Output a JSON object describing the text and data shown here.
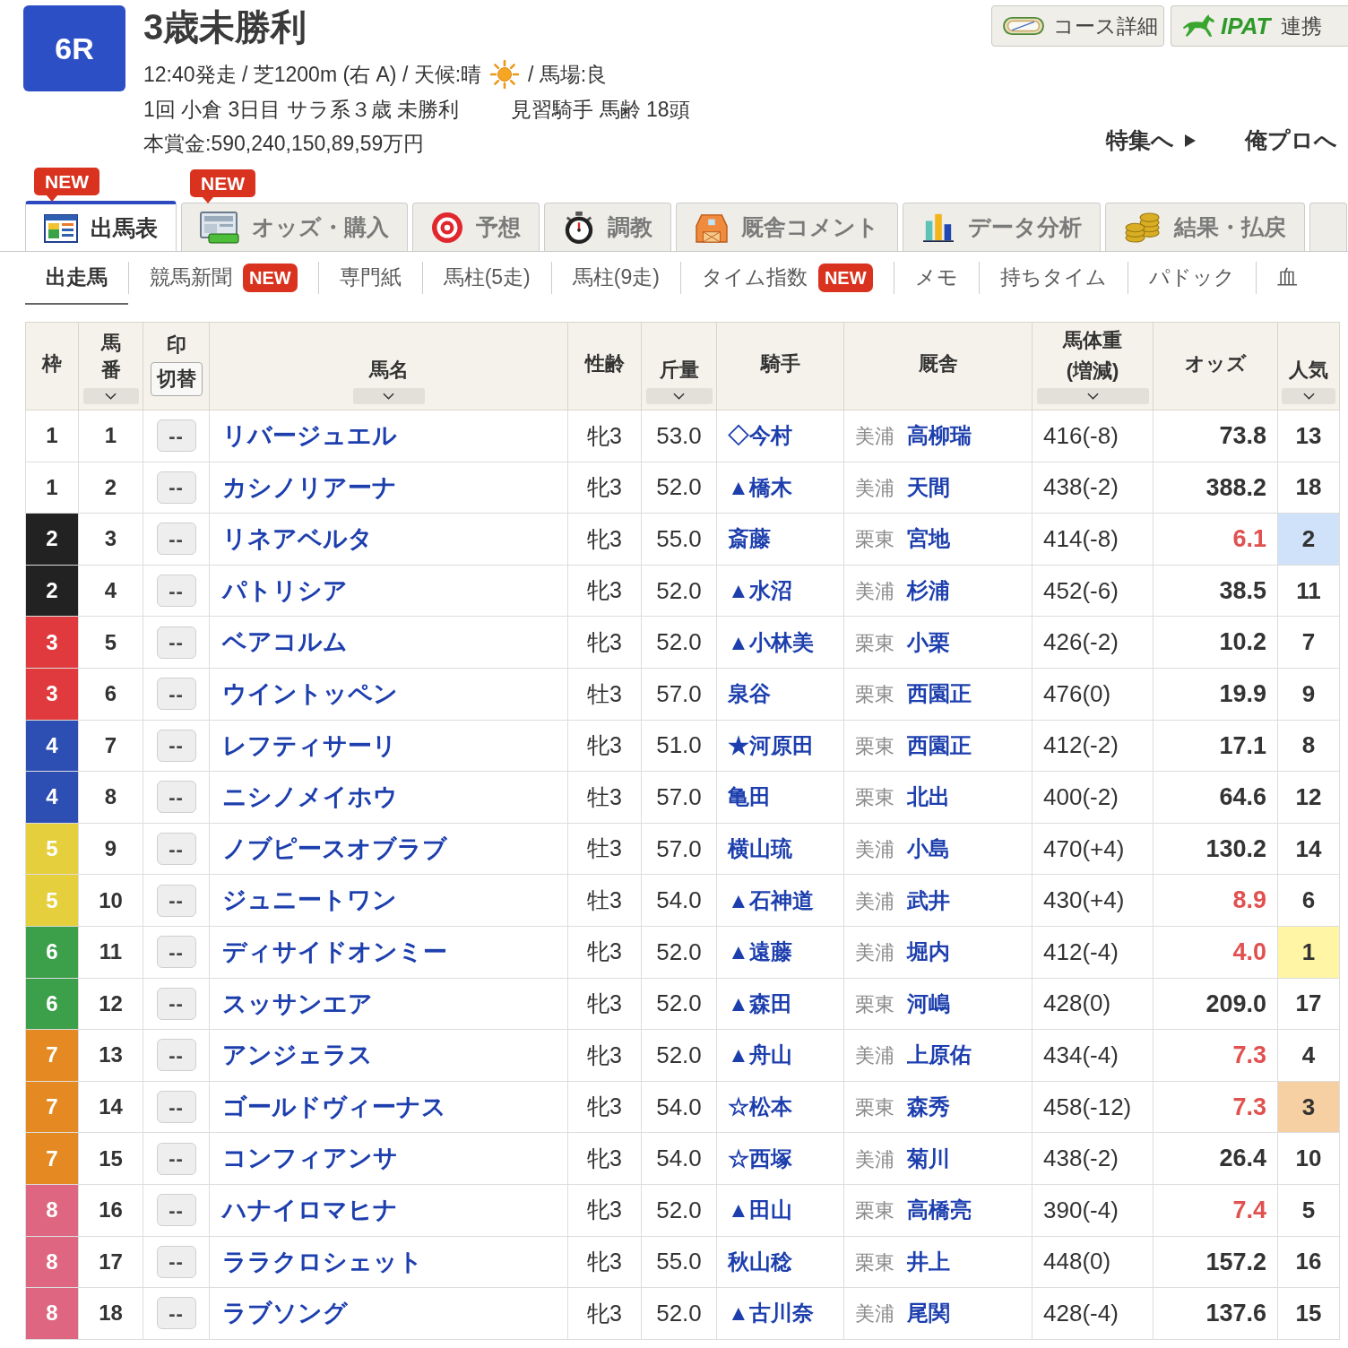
{
  "race": {
    "number": "6R",
    "title": "3歳未勝利",
    "schedule": "12:40発走 / 芝1200m (右 A) / 天候:晴",
    "track_condition": "/ 馬場:良",
    "meeting": "1回 小倉 3日目 サラ系３歳 未勝利",
    "conditions": "見習騎手 馬齢 18頭",
    "prize": "本賞金:590,240,150,89,59万円"
  },
  "header_buttons": [
    {
      "kind": "course",
      "label": "コース詳細"
    },
    {
      "kind": "ipat",
      "logo_text": "IPAT",
      "label": "連携"
    }
  ],
  "header_links": [
    {
      "label": "特集へ",
      "arrow": true
    },
    {
      "label": "俺プロへ",
      "arrow": false
    }
  ],
  "tabs": [
    {
      "kind": "entries",
      "label": "出馬表",
      "selected": true,
      "badge": "NEW"
    },
    {
      "kind": "odds",
      "label": "オッズ・購入",
      "selected": false,
      "badge": "NEW"
    },
    {
      "kind": "prediction",
      "label": "予想",
      "selected": false
    },
    {
      "kind": "training",
      "label": "調教",
      "selected": false
    },
    {
      "kind": "stable",
      "label": "厩舎コメント",
      "selected": false
    },
    {
      "kind": "analysis",
      "label": "データ分析",
      "selected": false
    },
    {
      "kind": "results",
      "label": "結果・払戻",
      "selected": false
    },
    {
      "kind": "clipped",
      "selected": false
    }
  ],
  "subnav": [
    {
      "label": "出走馬",
      "selected": true
    },
    {
      "label": "競馬新聞",
      "selected": false,
      "badge": "NEW"
    },
    {
      "label": "専門紙",
      "selected": false
    },
    {
      "label": "馬柱(5走)",
      "selected": false
    },
    {
      "label": "馬柱(9走)",
      "selected": false
    },
    {
      "label": "タイム指数",
      "selected": false,
      "badge": "NEW"
    },
    {
      "label": "メモ",
      "selected": false
    },
    {
      "label": "持ちタイム",
      "selected": false
    },
    {
      "label": "パドック",
      "selected": false
    },
    {
      "label": "血",
      "selected": false
    }
  ],
  "table": {
    "columns": [
      {
        "label": "枠",
        "sortable": false
      },
      {
        "label": "馬番",
        "sortable": true
      },
      {
        "label": "印",
        "sortable": false,
        "button": "切替"
      },
      {
        "label": "馬名",
        "sortable": true
      },
      {
        "label": "性齢",
        "sortable": false
      },
      {
        "label": "斤量",
        "sortable": true
      },
      {
        "label": "騎手",
        "sortable": false
      },
      {
        "label": "厩舎",
        "sortable": false
      },
      {
        "label": "馬体重",
        "sublabel": "(増減)",
        "sortable": true
      },
      {
        "label": "オッズ",
        "sortable": false
      },
      {
        "label": "人気",
        "sortable": true
      }
    ],
    "rows": [
      {
        "waku": "1",
        "color": "#ffffff",
        "number": "1",
        "mark": "--",
        "name": "リバージュエル",
        "sex_age": "牝3",
        "weight": "53.0",
        "jockey": "◇今村",
        "affiliation": "美浦",
        "trainer": "高柳瑞",
        "body_weight": "416(-8)",
        "odds": "73.8",
        "odds_hot": false,
        "popularity": {
          "rank": "13"
        }
      },
      {
        "waku": "1",
        "color": "#ffffff",
        "number": "2",
        "mark": "--",
        "name": "カシノリアーナ",
        "sex_age": "牝3",
        "weight": "52.0",
        "jockey": "▲橋木",
        "affiliation": "美浦",
        "trainer": "天間",
        "body_weight": "438(-2)",
        "odds": "388.2",
        "odds_hot": false,
        "popularity": {
          "rank": "18"
        }
      },
      {
        "waku": "2",
        "color": "#222222",
        "number": "3",
        "mark": "--",
        "name": "リネアベルタ",
        "sex_age": "牝3",
        "weight": "55.0",
        "jockey": "斎藤",
        "affiliation": "栗東",
        "trainer": "宮地",
        "body_weight": "414(-8)",
        "odds": "6.1",
        "odds_hot": true,
        "popularity": {
          "rank": "2",
          "color": "#cfe2fa"
        }
      },
      {
        "waku": "2",
        "color": "#222222",
        "number": "4",
        "mark": "--",
        "name": "パトリシア",
        "sex_age": "牝3",
        "weight": "52.0",
        "jockey": "▲水沼",
        "affiliation": "美浦",
        "trainer": "杉浦",
        "body_weight": "452(-6)",
        "odds": "38.5",
        "odds_hot": false,
        "popularity": {
          "rank": "11"
        }
      },
      {
        "waku": "3",
        "color": "#e03a3e",
        "number": "5",
        "mark": "--",
        "name": "ベアコルム",
        "sex_age": "牝3",
        "weight": "52.0",
        "jockey": "▲小林美",
        "affiliation": "栗東",
        "trainer": "小栗",
        "body_weight": "426(-2)",
        "odds": "10.2",
        "odds_hot": false,
        "popularity": {
          "rank": "7"
        }
      },
      {
        "waku": "3",
        "color": "#e03a3e",
        "number": "6",
        "mark": "--",
        "name": "ウイントッペン",
        "sex_age": "牡3",
        "weight": "57.0",
        "jockey": "泉谷",
        "affiliation": "栗東",
        "trainer": "西園正",
        "body_weight": "476(0)",
        "odds": "19.9",
        "odds_hot": false,
        "popularity": {
          "rank": "9"
        }
      },
      {
        "waku": "4",
        "color": "#2d4fb4",
        "number": "7",
        "mark": "--",
        "name": "レフティサーリ",
        "sex_age": "牝3",
        "weight": "51.0",
        "jockey": "★河原田",
        "affiliation": "栗東",
        "trainer": "西園正",
        "body_weight": "412(-2)",
        "odds": "17.1",
        "odds_hot": false,
        "popularity": {
          "rank": "8"
        }
      },
      {
        "waku": "4",
        "color": "#2d4fb4",
        "number": "8",
        "mark": "--",
        "name": "ニシノメイホウ",
        "sex_age": "牡3",
        "weight": "57.0",
        "jockey": "亀田",
        "affiliation": "栗東",
        "trainer": "北出",
        "body_weight": "400(-2)",
        "odds": "64.6",
        "odds_hot": false,
        "popularity": {
          "rank": "12"
        }
      },
      {
        "waku": "5",
        "color": "#e5cf3c",
        "number": "9",
        "mark": "--",
        "name": "ノブピースオブラブ",
        "sex_age": "牡3",
        "weight": "57.0",
        "jockey": "横山琉",
        "affiliation": "美浦",
        "trainer": "小島",
        "body_weight": "470(+4)",
        "odds": "130.2",
        "odds_hot": false,
        "popularity": {
          "rank": "14"
        }
      },
      {
        "waku": "5",
        "color": "#e5cf3c",
        "number": "10",
        "mark": "--",
        "name": "ジュニートワン",
        "sex_age": "牡3",
        "weight": "54.0",
        "jockey": "▲石神道",
        "affiliation": "美浦",
        "trainer": "武井",
        "body_weight": "430(+4)",
        "odds": "8.9",
        "odds_hot": true,
        "popularity": {
          "rank": "6"
        }
      },
      {
        "waku": "6",
        "color": "#3c9f4a",
        "number": "11",
        "mark": "--",
        "name": "ディサイドオンミー",
        "sex_age": "牝3",
        "weight": "52.0",
        "jockey": "▲遠藤",
        "affiliation": "美浦",
        "trainer": "堀内",
        "body_weight": "412(-4)",
        "odds": "4.0",
        "odds_hot": true,
        "popularity": {
          "rank": "1",
          "color": "#fff5a5"
        }
      },
      {
        "waku": "6",
        "color": "#3c9f4a",
        "number": "12",
        "mark": "--",
        "name": "スッサンエア",
        "sex_age": "牝3",
        "weight": "52.0",
        "jockey": "▲森田",
        "affiliation": "栗東",
        "trainer": "河嶋",
        "body_weight": "428(0)",
        "odds": "209.0",
        "odds_hot": false,
        "popularity": {
          "rank": "17"
        }
      },
      {
        "waku": "7",
        "color": "#e58a22",
        "number": "13",
        "mark": "--",
        "name": "アンジェラス",
        "sex_age": "牝3",
        "weight": "52.0",
        "jockey": "▲舟山",
        "affiliation": "美浦",
        "trainer": "上原佑",
        "body_weight": "434(-4)",
        "odds": "7.3",
        "odds_hot": true,
        "popularity": {
          "rank": "4"
        }
      },
      {
        "waku": "7",
        "color": "#e58a22",
        "number": "14",
        "mark": "--",
        "name": "ゴールドヴィーナス",
        "sex_age": "牝3",
        "weight": "54.0",
        "jockey": "☆松本",
        "affiliation": "栗東",
        "trainer": "森秀",
        "body_weight": "458(-12)",
        "odds": "7.3",
        "odds_hot": true,
        "popularity": {
          "rank": "3",
          "color": "#f6cfa2"
        }
      },
      {
        "waku": "7",
        "color": "#e58a22",
        "number": "15",
        "mark": "--",
        "name": "コンフィアンサ",
        "sex_age": "牝3",
        "weight": "54.0",
        "jockey": "☆西塚",
        "affiliation": "美浦",
        "trainer": "菊川",
        "body_weight": "438(-2)",
        "odds": "26.4",
        "odds_hot": false,
        "popularity": {
          "rank": "10"
        }
      },
      {
        "waku": "8",
        "color": "#df6680",
        "number": "16",
        "mark": "--",
        "name": "ハナイロマヒナ",
        "sex_age": "牝3",
        "weight": "52.0",
        "jockey": "▲田山",
        "affiliation": "栗東",
        "trainer": "高橋亮",
        "body_weight": "390(-4)",
        "odds": "7.4",
        "odds_hot": true,
        "popularity": {
          "rank": "5"
        }
      },
      {
        "waku": "8",
        "color": "#df6680",
        "number": "17",
        "mark": "--",
        "name": "ララクロシェット",
        "sex_age": "牝3",
        "weight": "55.0",
        "jockey": "秋山稔",
        "affiliation": "栗東",
        "trainer": "井上",
        "body_weight": "448(0)",
        "odds": "157.2",
        "odds_hot": false,
        "popularity": {
          "rank": "16"
        }
      },
      {
        "waku": "8",
        "color": "#df6680",
        "number": "18",
        "mark": "--",
        "name": "ラブソング",
        "sex_age": "牝3",
        "weight": "52.0",
        "jockey": "▲古川奈",
        "affiliation": "美浦",
        "trainer": "尾関",
        "body_weight": "428(-4)",
        "odds": "137.6",
        "odds_hot": false,
        "popularity": {
          "rank": "15"
        }
      }
    ]
  }
}
